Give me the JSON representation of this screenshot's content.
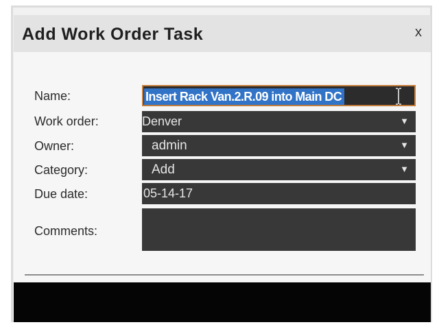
{
  "dialog": {
    "title": "Add Work Order Task",
    "close_label": "x"
  },
  "form": {
    "name_label": "Name:",
    "name_value": "Insert Rack Van.2.R.09 into Main DC",
    "work_order_label": "Work order:",
    "work_order_value": "Denver",
    "owner_label": "Owner:",
    "owner_value": "admin",
    "category_label": "Category:",
    "category_value": "Add",
    "due_date_label": "Due date:",
    "due_date_value": "05-14-17",
    "comments_label": "Comments:",
    "comments_value": ""
  },
  "colors": {
    "field_background": "#383838",
    "selection_highlight": "#3173c6",
    "focus_border": "#c47c3a",
    "title_bar": "#e3e3e3"
  },
  "icons": {
    "dropdown": "chevron-down-icon",
    "text_cursor": "i-beam-cursor-icon"
  }
}
